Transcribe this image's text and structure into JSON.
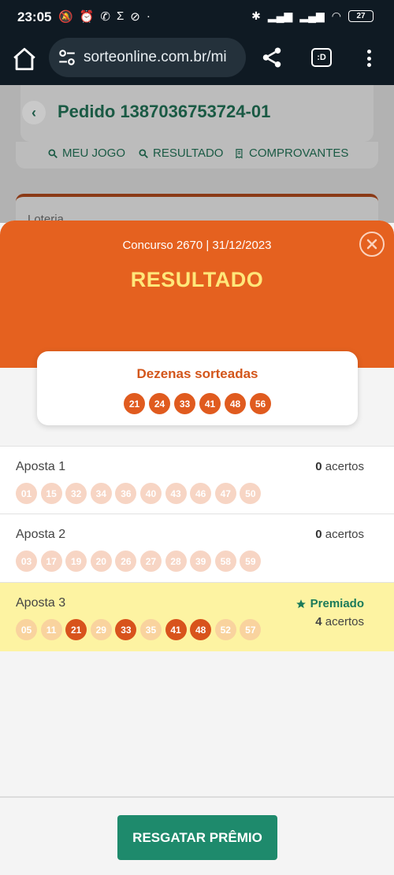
{
  "status_bar": {
    "time": "23:05",
    "battery": "27"
  },
  "browser": {
    "url": "sorteonline.com.br/mi"
  },
  "order_page": {
    "title": "Pedido 1387036753724-01",
    "tabs": [
      "MEU JOGO",
      "RESULTADO",
      "COMPROVANTES"
    ],
    "lottery_label": "Loteria"
  },
  "result_sheet": {
    "concurso": "Concurso 2670 | 31/12/2023",
    "title": "RESULTADO",
    "drawn_title": "Dezenas sorteadas",
    "drawn_numbers": [
      "21",
      "24",
      "33",
      "41",
      "48",
      "56"
    ],
    "bets": [
      {
        "name": "Aposta 1",
        "hits_count": "0",
        "hits_label": "acertos",
        "numbers": [
          "01",
          "15",
          "32",
          "34",
          "36",
          "40",
          "43",
          "46",
          "47",
          "50"
        ],
        "hit_flags": [
          false,
          false,
          false,
          false,
          false,
          false,
          false,
          false,
          false,
          false
        ],
        "prize": false
      },
      {
        "name": "Aposta 2",
        "hits_count": "0",
        "hits_label": "acertos",
        "numbers": [
          "03",
          "17",
          "19",
          "20",
          "26",
          "27",
          "28",
          "39",
          "58",
          "59"
        ],
        "hit_flags": [
          false,
          false,
          false,
          false,
          false,
          false,
          false,
          false,
          false,
          false
        ],
        "prize": false
      },
      {
        "name": "Aposta 3",
        "hits_count": "4",
        "hits_label": "acertos",
        "prize_label": "Premiado",
        "numbers": [
          "05",
          "11",
          "21",
          "29",
          "33",
          "35",
          "41",
          "48",
          "52",
          "57"
        ],
        "hit_flags": [
          false,
          false,
          true,
          false,
          true,
          false,
          true,
          true,
          false,
          false
        ],
        "prize": true
      }
    ],
    "claim_button": "RESGATAR PRÊMIO"
  },
  "colors": {
    "accent_orange": "#e5611f",
    "title_yellow": "#ffe77a",
    "primary_green": "#1e8a6c",
    "prize_bg": "#fdf3a2"
  }
}
